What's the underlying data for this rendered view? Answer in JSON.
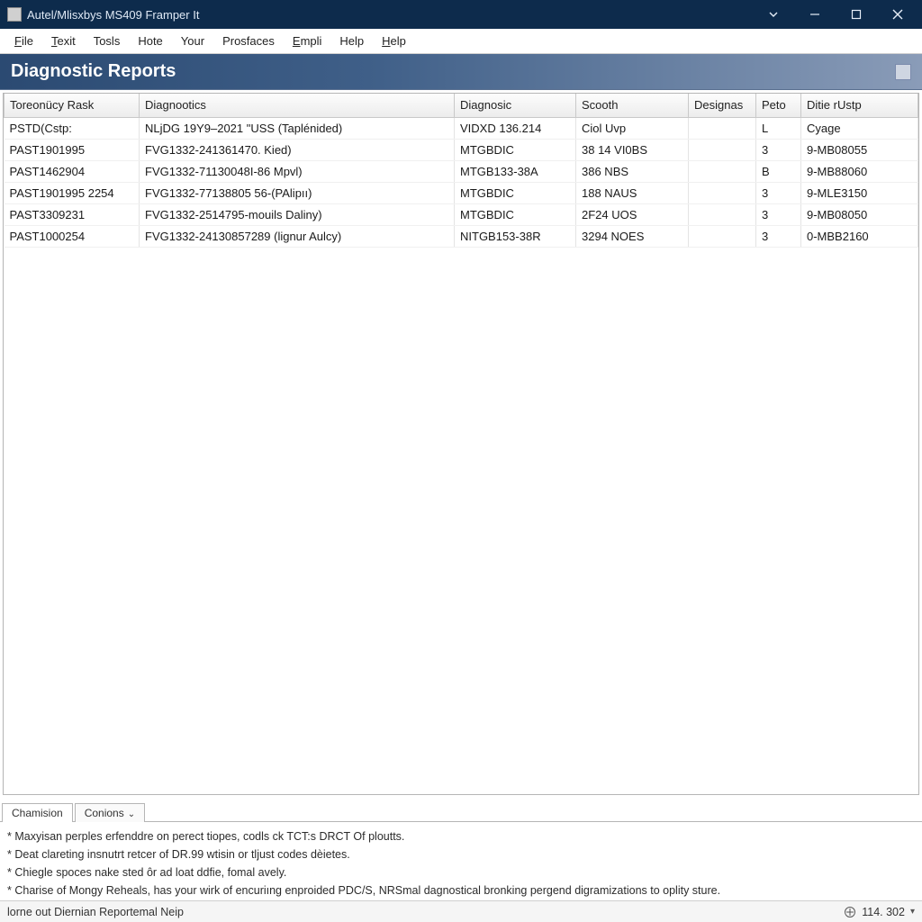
{
  "window": {
    "title": "Autel/Mlisxbys MS409 Framper It"
  },
  "menu": {
    "items": [
      {
        "label": "File",
        "u": 0
      },
      {
        "label": "Texit",
        "u": 0
      },
      {
        "label": "Tosls",
        "u": -1
      },
      {
        "label": "Hote",
        "u": -1
      },
      {
        "label": "Your",
        "u": -1
      },
      {
        "label": "Prosfaces",
        "u": -1
      },
      {
        "label": "Empli",
        "u": 0
      },
      {
        "label": "Help",
        "u": -1
      },
      {
        "label": "Help",
        "u": 0
      }
    ]
  },
  "header": {
    "title": "Diagnostic Reports"
  },
  "table": {
    "columns": [
      "Toreonücy Rask",
      "Diagnootics",
      "Diagnosic",
      "Scooth",
      "Designas",
      "Peto",
      "Ditie rUstp"
    ],
    "rows": [
      [
        "PSTD(Cstp:",
        "NLjDG 19Y9–2021 \"USS (Taplénided)",
        "VIDXD 136.214",
        "Ciol Uvp",
        "",
        "L",
        "Cyage"
      ],
      [
        "PAST1901995",
        "FVG1332-241361470. Kied)",
        "MTGBDIC",
        "38 14 VI0BS",
        "",
        "3",
        "9-MB08055"
      ],
      [
        "PAST1462904",
        "FVG1332-71130048I-86 Mpvl)",
        "MTGB133-38A",
        "386 NBS",
        "",
        "B",
        "9-MB88060"
      ],
      [
        "PAST1901995 2254",
        "FVG1332-77138805 56-(PAlipıı)",
        "MTGBDIC",
        "188 NAUS",
        "",
        "3",
        "9-MLE3150"
      ],
      [
        "PAST3309231",
        "FVG1332-2514795-mouils Daliny)",
        "MTGBDIC",
        "2F24 UOS",
        "",
        "3",
        "9-MB08050"
      ],
      [
        "PAST1000254",
        "FVG1332-24130857289 (lignur Aulcy)",
        "NITGB153-38R",
        "3294 NOES",
        "",
        "3",
        "0-MBB2160"
      ]
    ]
  },
  "tabs": {
    "items": [
      {
        "label": "Chamision",
        "active": true,
        "chevron": false
      },
      {
        "label": "Conions",
        "active": false,
        "chevron": true
      }
    ]
  },
  "notes": {
    "lines": [
      "* Maxyisan perples erfenddre on perect tiopes, codls ck TCT:s DRCT Of ploutts.",
      "* Deat clareting insnutrt retcer of DR.99 wtisin or tljust codes dèietes.",
      "* Chiegle spoces nake sted ôr ad loat ddfie, fomal avely.",
      "* Charise of Mongy Reheals, has your wirk of encuriıng enproided PDC/S, NRSmal dagnostical bronking pergend digramizations to oplity sture."
    ]
  },
  "statusbar": {
    "left": "lorne out Diernian Reportemal Neip",
    "right": "114. 302"
  }
}
